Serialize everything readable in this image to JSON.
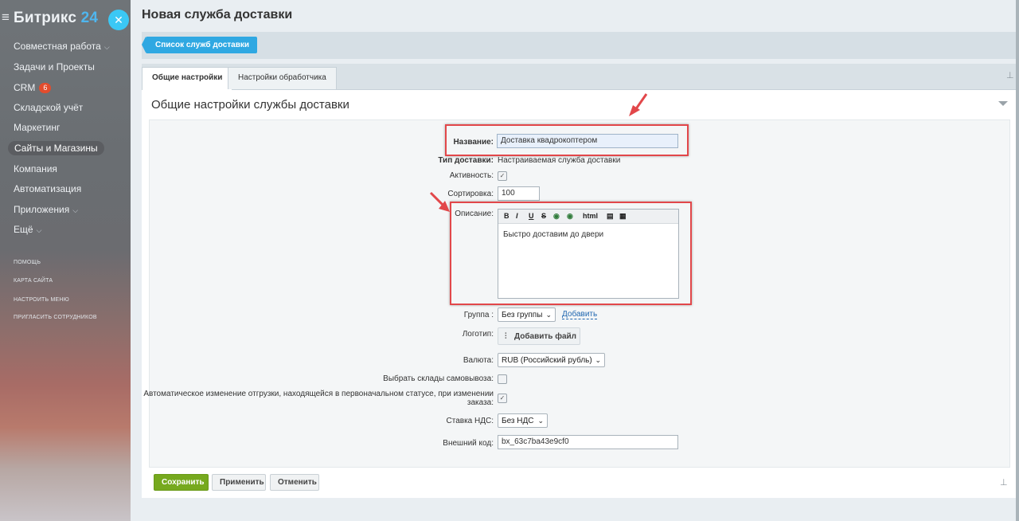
{
  "sidebar": {
    "logo_main": "Битрикс",
    "logo_num": "24",
    "close_icon": "✕",
    "menu": [
      {
        "label": "Совместная работа",
        "chevron": "⌵"
      },
      {
        "label": "Задачи и Проекты"
      },
      {
        "label": "CRM",
        "badge": "6"
      },
      {
        "label": "Складской учёт"
      },
      {
        "label": "Маркетинг"
      },
      {
        "label": "Сайты и Магазины",
        "active": true
      },
      {
        "label": "Компания"
      },
      {
        "label": "Автоматизация"
      },
      {
        "label": "Приложения",
        "chevron": "⌵"
      },
      {
        "label": "Ещё",
        "chevron": "⌵"
      }
    ],
    "small_links": [
      "ПОМОЩЬ",
      "КАРТА САЙТА",
      "НАСТРОИТЬ МЕНЮ",
      "ПРИГЛАСИТЬ СОТРУДНИКОВ"
    ]
  },
  "page": {
    "title": "Новая служба доставки",
    "back_button": "Список служб доставки",
    "tabs": [
      "Общие настройки",
      "Настройки обработчика"
    ],
    "section_title": "Общие настройки службы доставки"
  },
  "form": {
    "name_label": "Название:",
    "name_value": "Доставка квадрокоптером",
    "type_label": "Тип доставки:",
    "type_value": "Настраиваемая служба доставки",
    "active_label": "Активность:",
    "active_checked": true,
    "sort_label": "Сортировка:",
    "sort_value": "100",
    "desc_label": "Описание:",
    "desc_toolbar": {
      "b": "B",
      "i": "I",
      "u": "U",
      "s": "S",
      "html": "html"
    },
    "desc_value": "Быстро доставим до двери",
    "group_label": "Группа :",
    "group_value": "Без группы",
    "group_add": "Добавить",
    "logo_label": "Логотип:",
    "logo_button": "Добавить файл",
    "currency_label": "Валюта:",
    "currency_value": "RUB (Российский рубль)",
    "pickup_label": "Выбрать склады самовывоза:",
    "pickup_checked": false,
    "auto_change_label_1": "Автоматическое изменение отгрузки, находящейся в первоначальном статусе, при изменении",
    "auto_change_label_2": "заказа:",
    "auto_change_checked": true,
    "vat_label": "Ставка НДС:",
    "vat_value": "Без НДС",
    "ext_code_label": "Внешний код:",
    "ext_code_value": "bx_63c7ba43e9cf0"
  },
  "footer": {
    "save": "Сохранить",
    "apply": "Применить",
    "cancel": "Отменить"
  },
  "colors": {
    "accent_blue": "#2fa8e2",
    "save_green": "#76a91e",
    "highlight_red": "#e2474a"
  }
}
